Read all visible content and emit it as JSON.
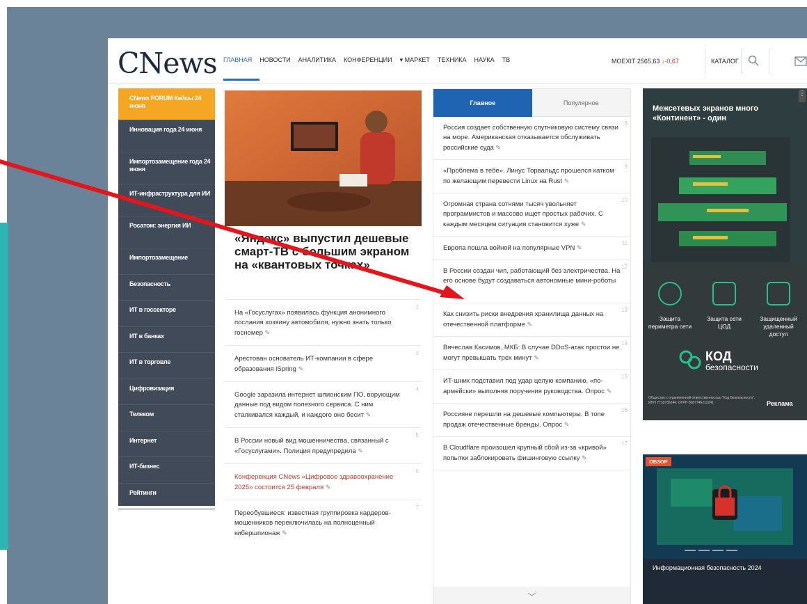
{
  "header": {
    "logo": "CNews",
    "nav": [
      {
        "label": "ГЛАВНАЯ",
        "active": true
      },
      {
        "label": "НОВОСТИ"
      },
      {
        "label": "АНАЛИТИКА"
      },
      {
        "label": "КОНФЕРЕНЦИИ"
      },
      {
        "label": "▾ МАРКЕТ"
      },
      {
        "label": "ТЕХНИКА"
      },
      {
        "label": "НАУКА"
      },
      {
        "label": "ТВ"
      }
    ],
    "moex_label": "MOEXIT 2565,63",
    "moex_change": "↓-0,67",
    "catalog": "КАТАЛОГ"
  },
  "sidebar": {
    "items": [
      "CNews FORUM Кейсы 24 июня",
      "Инновация года 24 июня",
      "Импортозамещение года 24 июня",
      "ИТ-инфраструктура для ИИ",
      "Росатом: энергия ИИ",
      "Импортозамещение",
      "Безопасность",
      "ИТ в госсекторе",
      "ИТ в банках",
      "ИТ в торговле",
      "Цифровизация",
      "Телеком",
      "Интернет",
      "ИТ-бизнес",
      "Рейтинги"
    ]
  },
  "feature": {
    "title": "«Яндекс» выпустил дешевые смарт-ТВ с большим экраном на «квантовых точках»"
  },
  "left_news": [
    {
      "num": "2",
      "text": "На «Госуслугах» появилась функция анонимного послания хозяину автомобиля, нужно знать только госномер"
    },
    {
      "num": "3",
      "text": "Арестован основатель ИТ-компании в сфере образования iSpring"
    },
    {
      "num": "4",
      "text": "Google заразила интернет шпионским ПО, ворующим данные под видом полезного сервиса. С ним сталкивался каждый, и каждого оно бесит"
    },
    {
      "num": "5",
      "text": "В России новый вид мошенничества, связанный с «Госуслугами». Полиция предупредила"
    },
    {
      "num": "6",
      "text": "Конференция CNews «Цифровое здравоохранение 2025» состоится 25 февраля",
      "red": true
    },
    {
      "num": "7",
      "text": "Переобувшиеся: известная группировка кардеров-мошенников переключилась на полноценный кибершпионаж"
    }
  ],
  "main": {
    "tabs": [
      "Главное",
      "Популярное"
    ],
    "items": [
      {
        "num": "8",
        "text": "Россия создает собственную спутниковую систему связи на море. Американская отказывается обслуживать российские суда"
      },
      {
        "num": "9",
        "text": "«Проблема в тебе». Линус Торвальдс прошелся катком по желающим перевести Linux на Rust"
      },
      {
        "num": "10",
        "text": "Огромная страна сотнями тысяч увольняет программистов и массово ищет простых рабочих. С каждым месяцем ситуация становится хуже"
      },
      {
        "num": "11",
        "text": "Европа пошла войной на популярные VPN"
      },
      {
        "num": "12",
        "text": "В России создан чип, работающий без электричества. На его основе будут создаваться автономные мини-роботы"
      },
      {
        "num": "13",
        "text": "Как снизить риски внедрения хранилища данных на отечественной платформе"
      },
      {
        "num": "14",
        "text": "Вячеслав Касимов, МКБ: В случае DDoS-атак простои не могут превышать трех минут"
      },
      {
        "num": "15",
        "text": "ИТ-шник подставил под удар целую компанию, «по-армейски» выполняя поручения руководства. Опрос"
      },
      {
        "num": "16",
        "text": "Россияне перешли на дешевые компьютеры. В топе продаж отечественные бренды. Опрос"
      },
      {
        "num": "17",
        "text": "В Cloudflare произошел крупный сбой из-за «кривой» попытки заблокировать фишинговую ссылку"
      }
    ]
  },
  "ad": {
    "title": "Межсетевых экранов много «Континент» - один",
    "captions": [
      "Защита периметра сети",
      "Защита сети ЦОД",
      "Защищенный удаленный доступ"
    ],
    "brand": "КОД",
    "brand_sub": "безопасности",
    "legal": "Общество с ограниченной ответственностью \"Код Безопасности\", ИНН 7718735244, ОГРН 5087746212241",
    "reklama": "Реклама"
  },
  "review": {
    "badge": "ОБЗОР",
    "title": "Информационная безопасность 2024"
  },
  "colors": {
    "accent": "#2b6dc4",
    "sidebar": "#414a58",
    "highlight": "#f5a623",
    "arrow": "#e3161b",
    "tab_active": "#1f64b3"
  }
}
